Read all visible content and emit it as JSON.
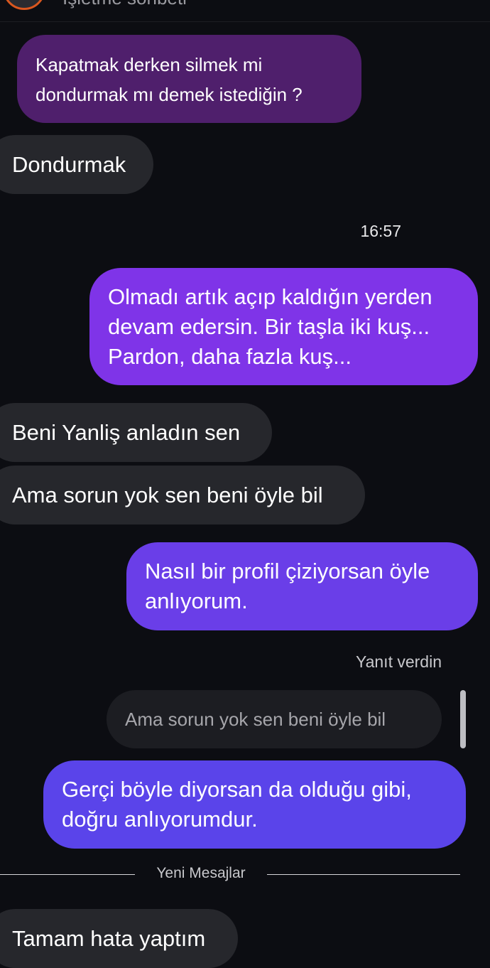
{
  "header": {
    "subtitle": "İşletme sohbeti"
  },
  "messages": [
    {
      "side": "outgoing",
      "lines": [
        "Kapatmak derken silmek mi",
        "dondurmak mı demek istediğin ?"
      ]
    },
    {
      "side": "incoming",
      "lines": [
        "Dondurmak"
      ]
    },
    {
      "type": "timestamp",
      "text": "16:57"
    },
    {
      "side": "outgoing",
      "lines": [
        "Olmadı artık açıp kaldığın yerden",
        "devam edersin. Bir taşla iki kuş...",
        "Pardon, daha fazla kuş..."
      ]
    },
    {
      "side": "incoming",
      "lines": [
        "Beni Yanliş anladın sen"
      ]
    },
    {
      "side": "incoming",
      "lines": [
        "Ama sorun yok sen beni öyle bil"
      ]
    },
    {
      "side": "outgoing",
      "lines": [
        "Nasıl bir profil çiziyorsan öyle",
        "anlıyorum."
      ]
    },
    {
      "side": "outgoing",
      "lines": [
        "Gerçi böyle diyorsan da olduğu gibi,",
        "doğru anlıyorumdur."
      ]
    },
    {
      "side": "incoming",
      "lines": [
        "Tamam hata yaptım"
      ]
    }
  ],
  "reply": {
    "label": "Yanıt verdin",
    "quoted_text": "Ama sorun yok sen beni öyle bil"
  },
  "divider": {
    "label": "Yeni Mesajlar"
  },
  "colors": {
    "background": "#0c0d12",
    "incoming_bubble": "#26272c",
    "outgoing_gradient": [
      "#4f1f6c",
      "#7f34e8",
      "#6a3ee8",
      "#5a44ea"
    ]
  }
}
